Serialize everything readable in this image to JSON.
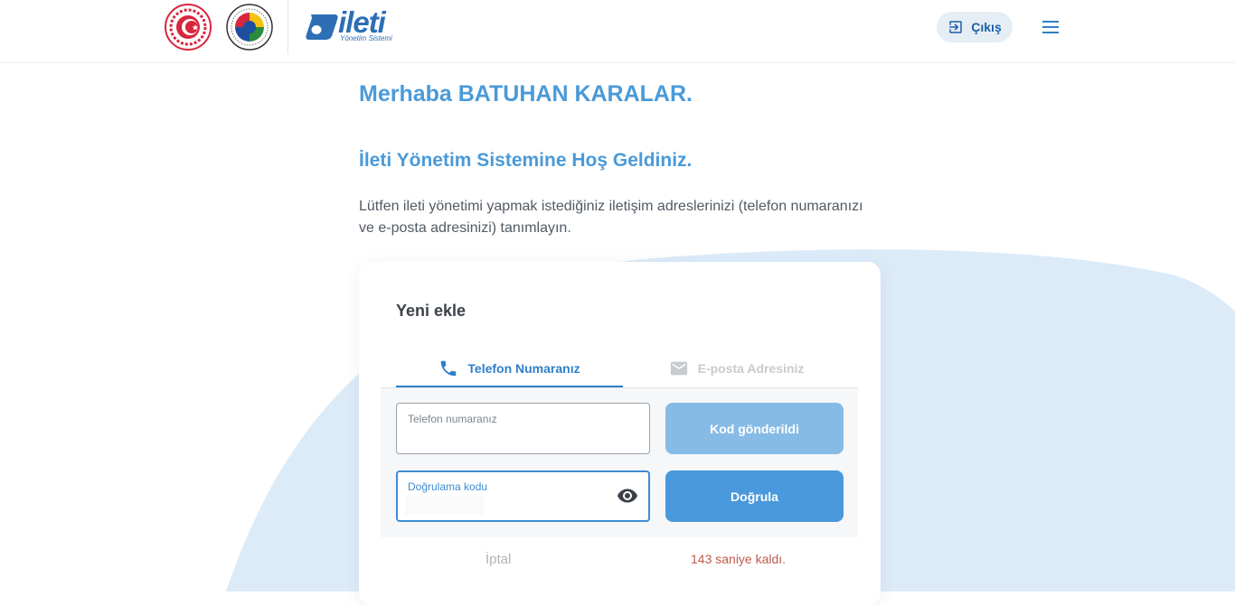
{
  "header": {
    "logos": [
      {
        "name": "ministry-emblem"
      },
      {
        "name": "tobb-emblem"
      }
    ],
    "brand": {
      "name": "ileti",
      "subtitle": "Yönetim Sistemi"
    },
    "logout_label": "Çıkış",
    "colors": {
      "brand": "#2d6eb5",
      "accent": "#4a9ad8"
    }
  },
  "greeting": "Merhaba BATUHAN KARALAR.",
  "welcome": "İleti Yönetim Sistemine Hoş Geldiniz.",
  "intro": "Lütfen ileti yönetimi yapmak istediğiniz iletişim adreslerinizi (telefon numaranızı ve e-posta adresinizi) tanımlayın.",
  "card": {
    "title": "Yeni ekle",
    "tabs": [
      {
        "label": "Telefon Numaranız",
        "icon": "phone-icon",
        "active": true
      },
      {
        "label": "E-posta Adresiniz",
        "icon": "mail-icon",
        "active": false
      }
    ],
    "phone_field": {
      "label": "Telefon numaranız",
      "value": ""
    },
    "code_field": {
      "label": "Doğrulama kodu",
      "value": ""
    },
    "send_button": "Kod gönderildi",
    "verify_button": "Doğrula",
    "cancel": "İptal",
    "countdown": "143 saniye kaldı."
  }
}
